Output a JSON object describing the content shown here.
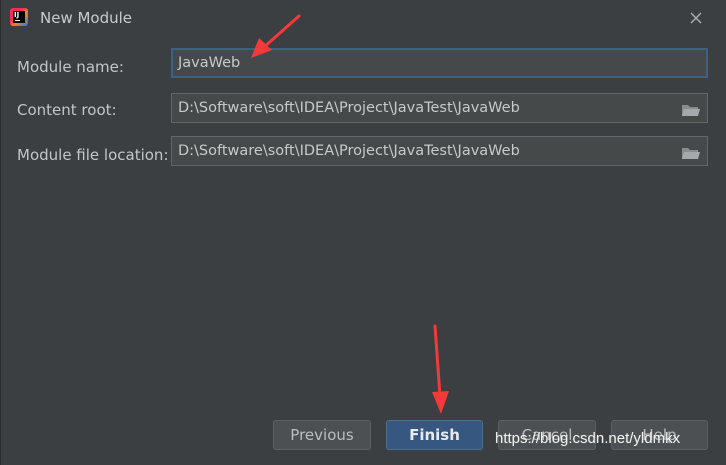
{
  "window": {
    "title": "New Module"
  },
  "form": {
    "module_name": {
      "label": "Module name:",
      "value": "JavaWeb"
    },
    "content_root": {
      "label": "Content root:",
      "value": "D:\\Software\\soft\\IDEA\\Project\\JavaTest\\JavaWeb"
    },
    "module_file_location": {
      "label": "Module file location:",
      "value": "D:\\Software\\soft\\IDEA\\Project\\JavaTest\\JavaWeb"
    }
  },
  "buttons": {
    "previous": "Previous",
    "finish": "Finish",
    "cancel": "Cancel",
    "help": "Help"
  },
  "watermark": "https://blog.csdn.net/yldmkx",
  "colors": {
    "background": "#3c3f41",
    "field_bg": "#45494a",
    "focus_border": "#3d6185",
    "primary_button": "#365880",
    "annotation_arrow": "#f23a3a"
  },
  "icons": {
    "app": "intellij-idea-icon",
    "close": "close-icon",
    "folder": "folder-icon"
  }
}
